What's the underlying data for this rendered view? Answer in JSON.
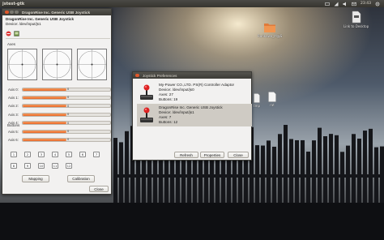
{
  "panel": {
    "app_title": "jstest-gtk",
    "clock": "23:43",
    "icons": [
      "keyboard-layout-icon",
      "network-icon",
      "volume-icon",
      "mail-icon",
      "power-gear-icon"
    ]
  },
  "desktop": {
    "icons": [
      {
        "label": "Rurikawa_M@S"
      },
      {
        "label": "Link to Desktop"
      },
      {
        "label": "tmp"
      },
      {
        "label": "rat"
      }
    ]
  },
  "joystick_window": {
    "device_name": "DragonRise Inc.   Generic   USB  Joystick",
    "device_path": "Device: /dev/input/js1",
    "axes_label": "Axes",
    "axes": [
      {
        "label": "Axis 0:",
        "value": 0.0,
        "value_text": "0"
      },
      {
        "label": "Axis 1:",
        "value": 0.0,
        "value_text": "0"
      },
      {
        "label": "Axis 2:",
        "value": 0.0,
        "value_text": "0"
      },
      {
        "label": "Axis 3:",
        "value": 0.0,
        "value_text": "0"
      },
      {
        "label": "Axis 4:",
        "value": 0.0,
        "value_text": "0"
      },
      {
        "label": "Axis 5:",
        "value": 0.0,
        "value_text": "0"
      },
      {
        "label": "Axis 6:",
        "value": 0.0,
        "value_text": "0"
      }
    ],
    "buttons_label": "Buttons",
    "buttons": [
      "1",
      "2",
      "3",
      "4",
      "5",
      "6",
      "7",
      "8",
      "9",
      "10",
      "11",
      "12"
    ],
    "mapping_label": "Mapping",
    "calibration_label": "Calibration",
    "close_label": "Close"
  },
  "prefs_dialog": {
    "title": "Joystick Preferences",
    "devices": [
      {
        "name": "My-Power CO.,LTD. PS(R) Controller Adaptor",
        "device": "Device: /dev/input/js0",
        "axes": "Axes: 27",
        "buttons": "Buttons: 19",
        "selected": false
      },
      {
        "name": "DragonRise Inc.   Generic   USB  Joystick",
        "device": "Device: /dev/input/js1",
        "axes": "Axes: 7",
        "buttons": "Buttons: 12",
        "selected": true
      }
    ],
    "refresh_label": "Refresh",
    "properties_label": "Properties",
    "close_label": "Close"
  },
  "colors": {
    "accent": "#e8692a",
    "titlebar": "#3c3b37",
    "window_bg": "#f2f1f0"
  }
}
